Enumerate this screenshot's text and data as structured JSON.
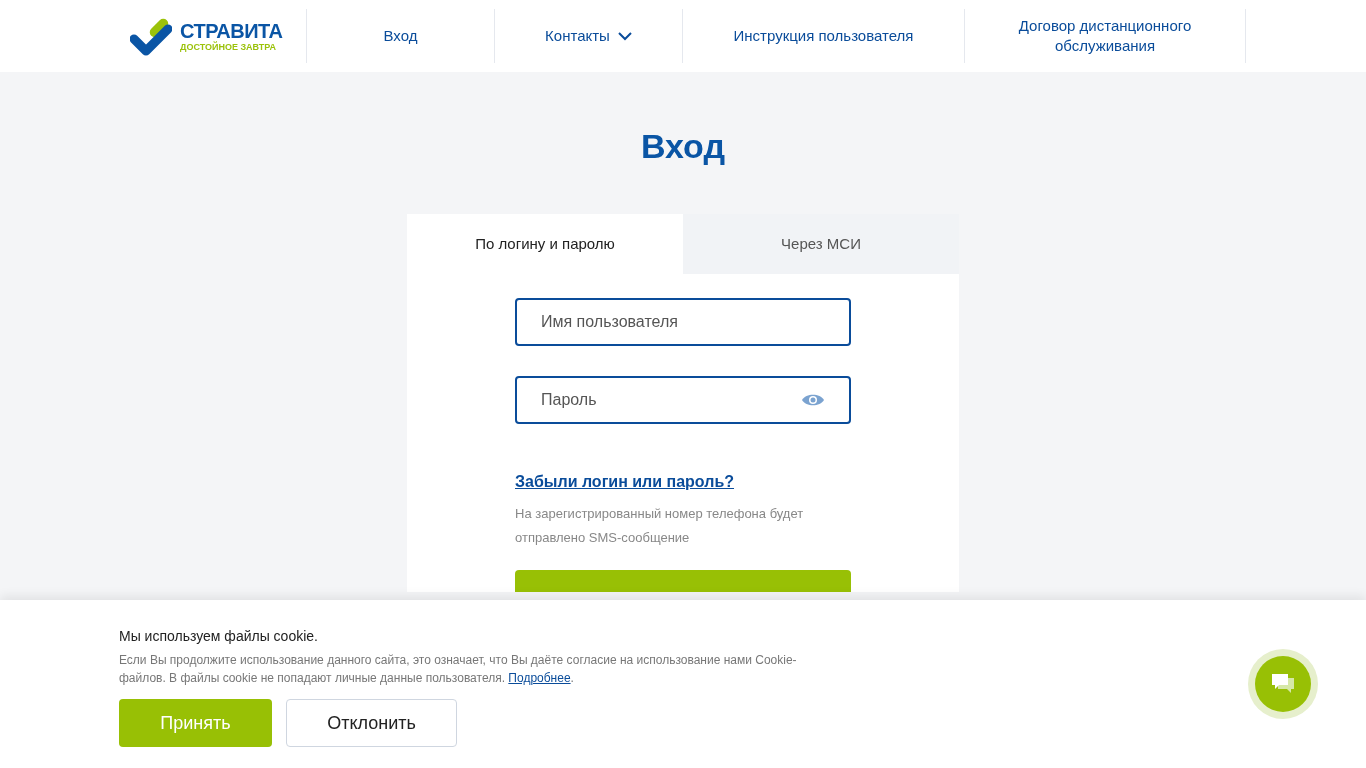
{
  "header": {
    "logo": {
      "name": "СТРАВИТА",
      "tagline": "ДОСТОЙНОЕ ЗАВТРА"
    },
    "nav": [
      {
        "label": "Вход",
        "kind": "link"
      },
      {
        "label": "Контакты",
        "kind": "dropdown"
      },
      {
        "label": "Инструкция пользователя",
        "kind": "link"
      },
      {
        "label": "Договор дистанционного обслуживания",
        "kind": "link"
      }
    ]
  },
  "page_title": "Вход",
  "tabs": [
    {
      "label": "По логину и паролю",
      "selected": true
    },
    {
      "label": "Через МСИ",
      "selected": false
    }
  ],
  "fields": [
    {
      "placeholder": "Имя пользователя",
      "kind": "text"
    },
    {
      "placeholder": "Пароль",
      "kind": "password"
    }
  ],
  "forgot_link": "Забыли логин или пароль?",
  "hint": "На зарегистрированный номер телефона будет отправлено SMS-сообщение",
  "cookie": {
    "title": "Мы используем файлы cookie.",
    "text": "Если Вы продолжите использование данного сайта, это означает, что Вы даёте согласие на использование нами Cookie-файлов. В файлы cookie не попадают личные данные пользователя. ",
    "link": "Подробнее",
    "suffix": ".",
    "buttons": [
      {
        "label": "Принять",
        "kind": "primary"
      },
      {
        "label": "Отклонить",
        "kind": "secondary"
      }
    ]
  }
}
